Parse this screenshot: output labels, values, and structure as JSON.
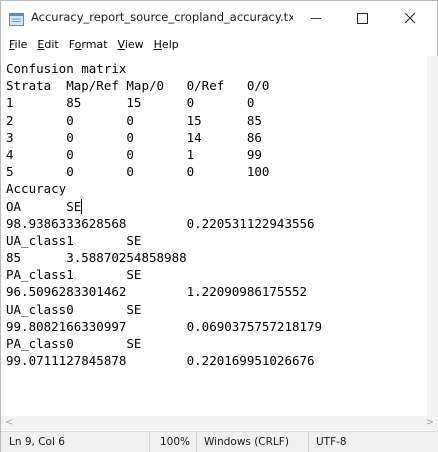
{
  "window": {
    "title": "Accuracy_report_source_cropland_accuracy.txt -...",
    "minimize_glyph": "—",
    "maximize_glyph": "☐",
    "close_glyph": "✕"
  },
  "menu": [
    "File",
    "Edit",
    "Format",
    "View",
    "Help"
  ],
  "menu_underline_index": [
    0,
    0,
    1,
    0,
    0
  ],
  "editor": {
    "lines": [
      "Confusion matrix",
      "Strata  Map/Ref Map/0   0/Ref   0/0",
      "1       85      15      0       0",
      "2       0       0       15      85",
      "3       0       0       14      86",
      "4       0       0       1       99",
      "5       0       0       0       100",
      "Accuracy",
      "OA      SE",
      "98.9386333628568        0.220531122943556",
      "UA_class1       SE",
      "85      3.58870254858988",
      "PA_class1       SE",
      "96.5096283301462        1.22090986175552",
      "UA_class0       SE",
      "99.8082166330997        0.0690375757218179",
      "PA_class0       SE",
      "99.0711127845878        0.220169951026676"
    ],
    "caret_line": 8
  },
  "scrollbar": {
    "left_arrow": "<",
    "right_arrow": ">"
  },
  "status": {
    "position": "Ln 9, Col 6",
    "zoom": "100%",
    "line_ending": "Windows (CRLF)",
    "encoding": "UTF-8"
  }
}
